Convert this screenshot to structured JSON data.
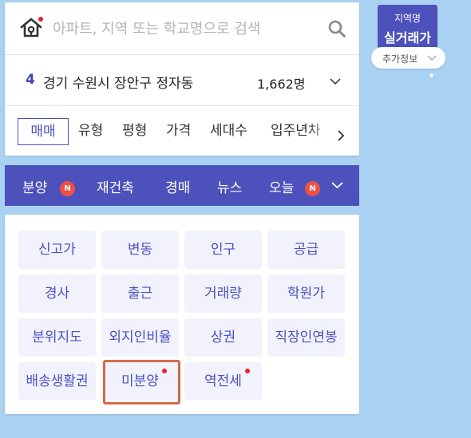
{
  "search": {
    "placeholder": "아파트, 지역 또는 학교명으로 검색"
  },
  "region": {
    "count": "4",
    "name": "경기 수원시 장안구 정자동",
    "population": "1,662명"
  },
  "filters": {
    "items": [
      "매매",
      "유형",
      "평형",
      "가격",
      "세대수",
      "입주년차"
    ]
  },
  "menu": {
    "items": [
      "분양",
      "재건축",
      "경매",
      "뉴스",
      "오늘"
    ],
    "badge": "N"
  },
  "grid": {
    "items": [
      "신고가",
      "변동",
      "인구",
      "공급",
      "경사",
      "출근",
      "거래량",
      "학원가",
      "분위지도",
      "외지인비율",
      "상권",
      "직장인연봉",
      "배송생활권",
      "미분양",
      "역전세"
    ]
  },
  "side_widget": {
    "sub_label": "지역명",
    "main_label": "실거래가",
    "extra_label": "추가정보"
  },
  "colors": {
    "accent": "#4c51bc",
    "background": "#a9d2f2",
    "badge_red": "#ef5046",
    "highlight": "#d46a4a"
  }
}
